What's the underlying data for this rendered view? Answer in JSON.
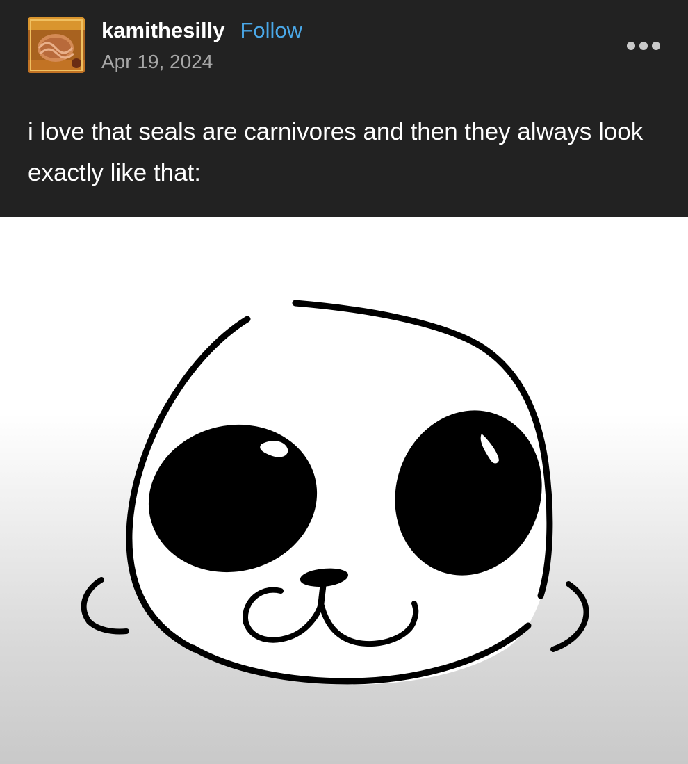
{
  "post": {
    "author": {
      "username": "kamithesilly",
      "avatar_icon": "avatar-image-icon"
    },
    "follow_label": "Follow",
    "date": "Apr 19, 2024",
    "more_icon": "ellipsis-icon",
    "text": "i love that seals are carnivores and then they always look exactly like that:"
  },
  "image": {
    "subject": "seal-face-drawing",
    "colors": {
      "ink": "#000000",
      "face": "#ffffff",
      "background_top": "#ffffff",
      "background_bottom": "#c9c9c9"
    }
  },
  "colors": {
    "header_bg": "#222222",
    "username": "#ffffff",
    "follow": "#4aa8e8",
    "date": "#a7a7a7",
    "text": "#ffffff"
  }
}
